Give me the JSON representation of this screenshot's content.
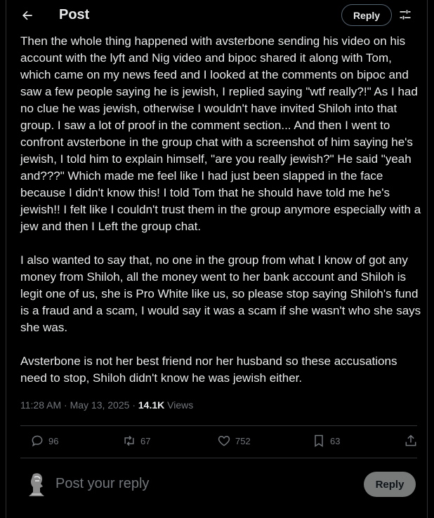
{
  "header": {
    "title": "Post",
    "reply_label": "Reply"
  },
  "post": {
    "body": "Then the whole thing happened with avsterbone sending his video on his account with the lyft and Nig video and bipoc shared it along with Tom, which came on my news feed and I looked at the comments on bipoc and saw a few people saying he is jewish, I replied saying \"wtf really?!\" As I had no clue he was jewish, otherwise I wouldn't have invited Shiloh into that group. I saw a lot of proof in the comment section... And then I went to confront avsterbone in the group chat with a screenshot of him saying he's jewish, I told him to explain himself, \"are you really jewish?\" He said \"yeah and???\" Which made me feel like I had just been slapped in the face because I didn't know this! I told Tom that he should have told me he's jewish!! I felt like I couldn't trust them in the group anymore especially with a jew and then I Left the group chat.\n\nI also wanted to say that, no one in the group from what I know of got any money from Shiloh, all the money went to her bank account and Shiloh is legit one of us, she is Pro White like us, so please stop saying Shiloh's fund is a fraud and a scam, I would say it was a scam if she wasn't who she says she was.\n\nAvsterbone is not her best friend nor her husband so these accusations need to stop, Shiloh didn't know he was jewish either.",
    "time": "11:28 AM",
    "separator": "·",
    "date": "May 13, 2025",
    "views_count": "14.1K",
    "views_label": "Views"
  },
  "actions": {
    "replies": "96",
    "reposts": "67",
    "likes": "752",
    "bookmarks": "63"
  },
  "composer": {
    "placeholder": "Post your reply",
    "reply_label": "Reply"
  },
  "icons": {
    "back": "arrow-left-icon",
    "settings": "sliders-icon",
    "reply": "speech-bubble-icon",
    "repost": "repost-icon",
    "like": "heart-icon",
    "bookmark": "bookmark-icon",
    "share": "share-icon"
  }
}
